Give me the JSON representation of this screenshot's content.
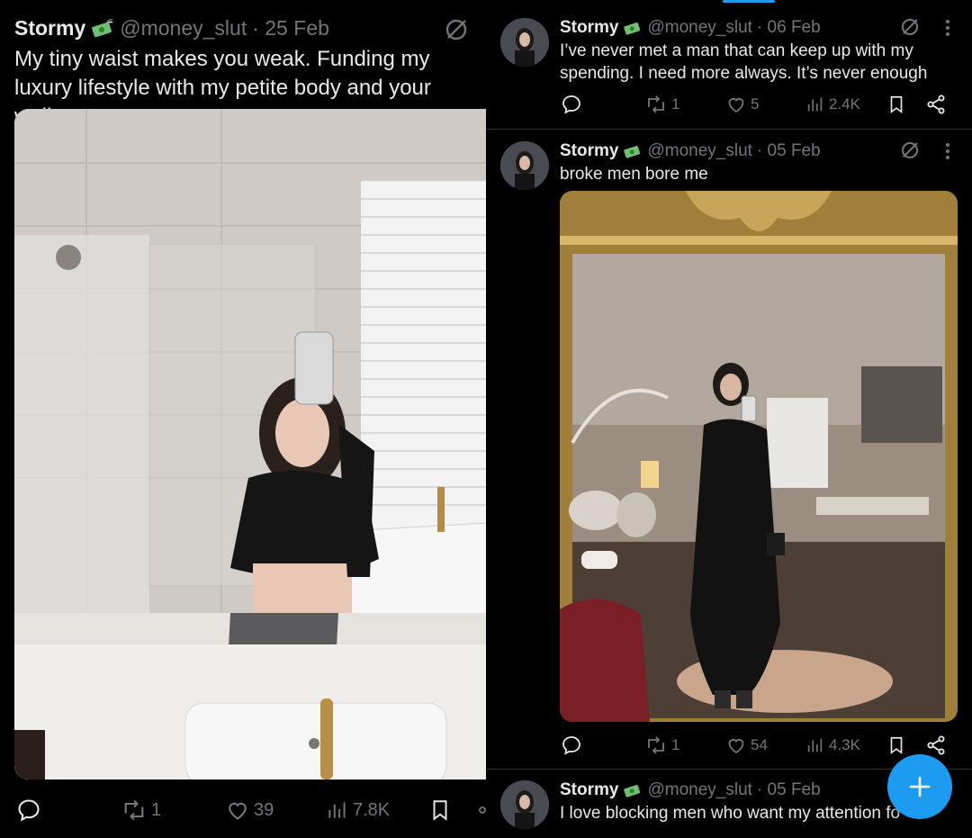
{
  "left_tweet": {
    "display_name": "Stormy",
    "handle": "@money_slut",
    "date": "· 25 Feb",
    "text": "My tiny waist makes you weak. Funding my luxury lifestyle with my petite body and your wallet",
    "media_description": "selfie-in-bathroom-mirror",
    "stats": {
      "reposts": "1",
      "likes": "39",
      "views": "7.8K"
    }
  },
  "right_tweets": [
    {
      "display_name": "Stormy",
      "handle": "@money_slut",
      "date": "· 06 Feb",
      "text": "I’ve never met a man that can keep up with my spending. I need more always. It’s never enough",
      "stats": {
        "reposts": "1",
        "likes": "5",
        "views": "2.4K"
      }
    },
    {
      "display_name": "Stormy",
      "handle": "@money_slut",
      "date": "· 05 Feb",
      "text": "broke men bore me",
      "stats": {
        "reposts": "1",
        "likes": "54",
        "views": "4.3K"
      }
    },
    {
      "display_name": "Stormy",
      "handle": "@money_slut",
      "date": "· 05 Feb",
      "text": "I love blocking men who want my attention fo"
    }
  ],
  "icons": {
    "verified_badge": "money-with-wings-emoji",
    "no_edit": "slashed-circle-icon",
    "compose": "plus-icon"
  },
  "colors": {
    "background": "#000000",
    "text": "#e7e9ea",
    "muted": "#71767b",
    "accent": "#1d9bf0"
  }
}
